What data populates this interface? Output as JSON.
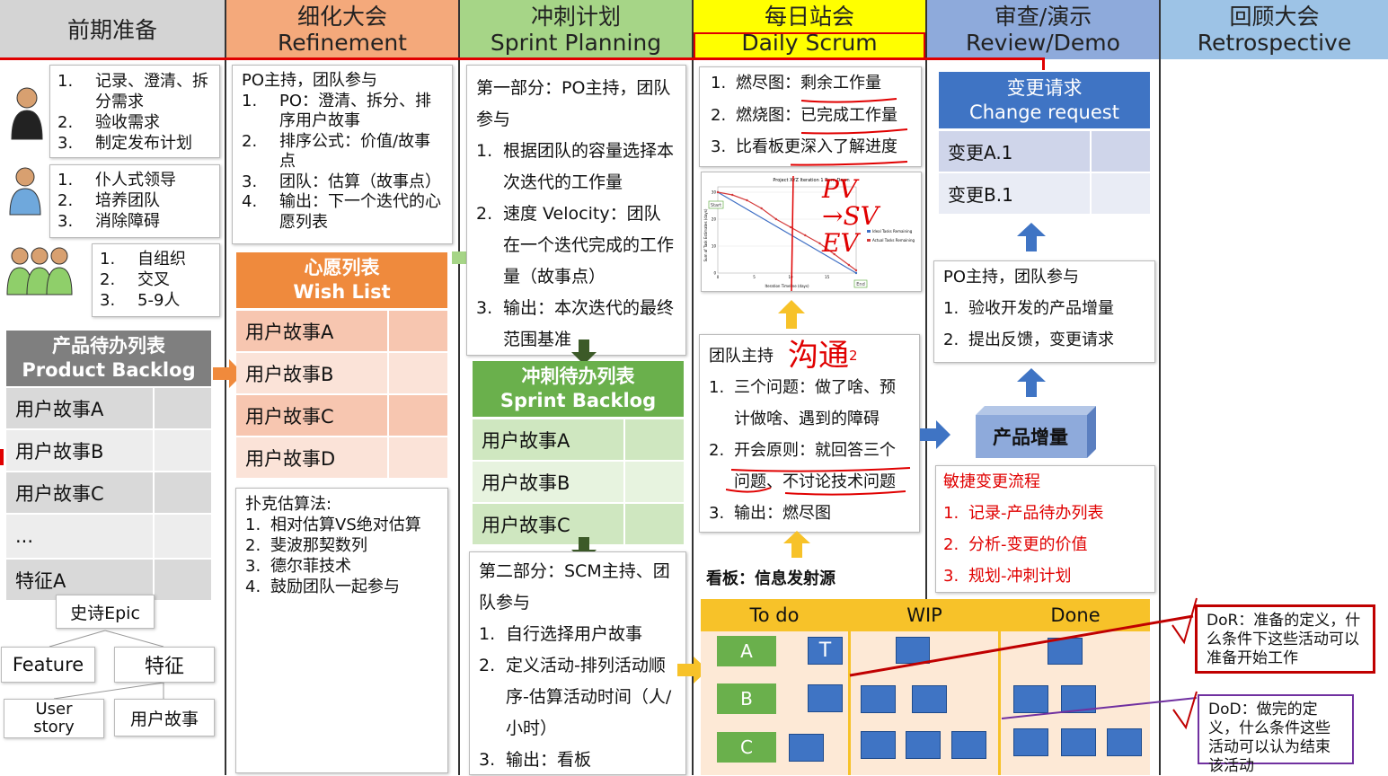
{
  "headers": [
    {
      "zh": "前期准备",
      "en": "",
      "color": "#d4d4d4"
    },
    {
      "zh": "细化大会",
      "en": "Refinement",
      "color": "#f4a97b"
    },
    {
      "zh": "冲刺计划",
      "en": "Sprint Planning",
      "color": "#a6d587"
    },
    {
      "zh": "每日站会",
      "en": "Daily Scrum",
      "color": "#ffff00"
    },
    {
      "zh": "审查/演示",
      "en": "Review/Demo",
      "color": "#8eaadb"
    },
    {
      "zh": "回顾大会",
      "en": "Retrospective",
      "color": "#9dc3e6"
    }
  ],
  "prep": {
    "po_roles": [
      "记录、澄清、拆分需求",
      "验收需求",
      "制定发布计划"
    ],
    "sm_roles": [
      "仆人式领导",
      "培养团队",
      "消除障碍"
    ],
    "team_roles": [
      "自组织",
      "交叉",
      "5-9人"
    ],
    "backlog_title": "产品待办列表",
    "backlog_title_en": "Product Backlog",
    "backlog_items": [
      "用户故事A",
      "用户故事B",
      "用户故事C",
      "...",
      "特征A"
    ],
    "epic": "史诗Epic",
    "feature_en": "Feature",
    "feature_zh": "特征",
    "story_en": "User story",
    "story_zh": "用户故事"
  },
  "refine": {
    "head": "PO主持，团队参与",
    "items": [
      "PO：澄清、拆分、排序用户故事",
      "排序公式：价值/故事点",
      "团队：估算（故事点）",
      "输出：下一个迭代的心愿列表"
    ],
    "wish_title": "心愿列表",
    "wish_title_en": "Wish List",
    "wish_items": [
      "用户故事A",
      "用户故事B",
      "用户故事C",
      "用户故事D"
    ],
    "poker_head": "扑克估算法:",
    "poker_items": [
      "相对估算VS绝对估算",
      "斐波那契数列",
      "德尔菲技术",
      "鼓励团队一起参与"
    ]
  },
  "plan": {
    "part1_head": "第一部分：PO主持，团队参与",
    "part1_items": [
      "根据团队的容量选择本次迭代的工作量",
      "速度 Velocity：团队在一个迭代完成的工作量（故事点）",
      "输出：本次迭代的最终范围基准"
    ],
    "sb_title": "冲刺待办列表",
    "sb_title_en": "Sprint Backlog",
    "sb_items": [
      "用户故事A",
      "用户故事B",
      "用户故事C"
    ],
    "part2_head": "第二部分：SCM主持、团队参与",
    "part2_items": [
      "自行选择用户故事",
      "定义活动-排列活动顺序-估算活动时间（人/小时）",
      "输出：看板"
    ]
  },
  "daily": {
    "charts": [
      "燃尽图：剩余工作量",
      "燃烧图：已完成工作量",
      "比看板更深入了解进度"
    ],
    "chart_title": "Project XYZ Iteration 1 Burn Down",
    "chart_start": "Start",
    "chart_end": "End",
    "chart_legend": [
      "Ideal Tasks Remaining",
      "Actual Tasks Remaining"
    ],
    "chart_xlabel": "Iteration Timeline (days)",
    "chart_ylabel": "Sum of Task Estimates (days)",
    "y_ticks": [
      "0",
      "10",
      "20",
      "30"
    ],
    "x_ticks": [
      "0",
      "5",
      "10",
      "15"
    ],
    "hand_note": "PV →SV EV",
    "meet_head": "团队主持",
    "meet_note": "沟通",
    "meet_sup": "2",
    "meet_items": [
      "三个问题：做了啥、预计做啥、遇到的障碍",
      "开会原则：就回答三个问题、不讨论技术问题",
      "输出：燃尽图"
    ],
    "kanban_label": "看板：信息发射源",
    "kanban_cols": [
      "To do",
      "WIP",
      "Done"
    ],
    "todo_cards": [
      "A",
      "B",
      "C"
    ],
    "todo_tag": "T"
  },
  "review": {
    "cr_title": "变更请求",
    "cr_title_en": "Change request",
    "cr_items": [
      "变更A.1",
      "变更B.1"
    ],
    "po_head": "PO主持，团队参与",
    "po_items": [
      "验收开发的产品增量",
      "提出反馈，变更请求"
    ],
    "inc_title": "产品增量",
    "flow_head": "敏捷变更流程",
    "flow_items": [
      "记录-产品待办列表",
      "分析-变更的价值",
      "规划-冲刺计划"
    ]
  },
  "retro": {
    "dor": "DoR：准备的定义，什么条件下这些活动可以准备开始工作",
    "dod": "DoD：做完的定义，什么条件这些活动可以认为结束该活动"
  },
  "chart_data": {
    "type": "line",
    "title": "Project XYZ Iteration 1 Burn Down",
    "xlabel": "Iteration Timeline (days)",
    "ylabel": "Sum of Task Estimates (days)",
    "xlim": [
      0,
      19
    ],
    "ylim": [
      0,
      32
    ],
    "series": [
      {
        "name": "Ideal Tasks Remaining",
        "color": "#3f6fc4",
        "x": [
          0,
          19
        ],
        "y": [
          30,
          0
        ]
      },
      {
        "name": "Actual Tasks Remaining",
        "color": "#d43a3a",
        "x": [
          0,
          2,
          4,
          6,
          8,
          10,
          12,
          14,
          16,
          18,
          19
        ],
        "y": [
          30,
          29,
          27,
          24,
          20,
          17,
          14,
          11,
          7,
          3,
          1
        ]
      }
    ]
  }
}
